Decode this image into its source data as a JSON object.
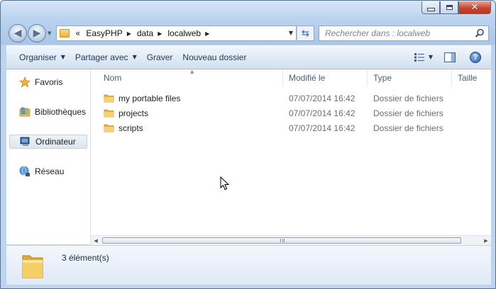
{
  "window": {
    "caption": {
      "minimize": "minimize",
      "maximize": "maximize",
      "close": "✕"
    }
  },
  "navigation": {
    "back_icon": "back-arrow-icon",
    "forward_icon": "forward-arrow-icon",
    "overflow": "«",
    "breadcrumbs": [
      "EasyPHP",
      "data",
      "localweb"
    ],
    "refresh_icon": "refresh-icon"
  },
  "search": {
    "placeholder": "Rechercher dans : localweb"
  },
  "toolbar": {
    "organise": "Organiser",
    "share": "Partager avec",
    "burn": "Graver",
    "new_folder": "Nouveau dossier",
    "help": "?"
  },
  "sidebar": {
    "items": [
      {
        "label": "Favoris",
        "icon": "star-icon"
      },
      {
        "label": "Bibliothèques",
        "icon": "library-icon"
      },
      {
        "label": "Ordinateur",
        "icon": "computer-icon",
        "selected": true
      },
      {
        "label": "Réseau",
        "icon": "network-icon"
      }
    ]
  },
  "columns": {
    "name": "Nom",
    "date": "Modifié le",
    "type": "Type",
    "size": "Taille"
  },
  "files": [
    {
      "name": "my portable files",
      "date": "07/07/2014 16:42",
      "type": "Dossier de fichiers"
    },
    {
      "name": "projects",
      "date": "07/07/2014 16:42",
      "type": "Dossier de fichiers"
    },
    {
      "name": "scripts",
      "date": "07/07/2014 16:42",
      "type": "Dossier de fichiers"
    }
  ],
  "status": {
    "count": "3 élément(s)"
  },
  "colors": {
    "accent": "#2c61a8",
    "folder": "#e8b53f",
    "toolbar_text": "#1e395b"
  }
}
